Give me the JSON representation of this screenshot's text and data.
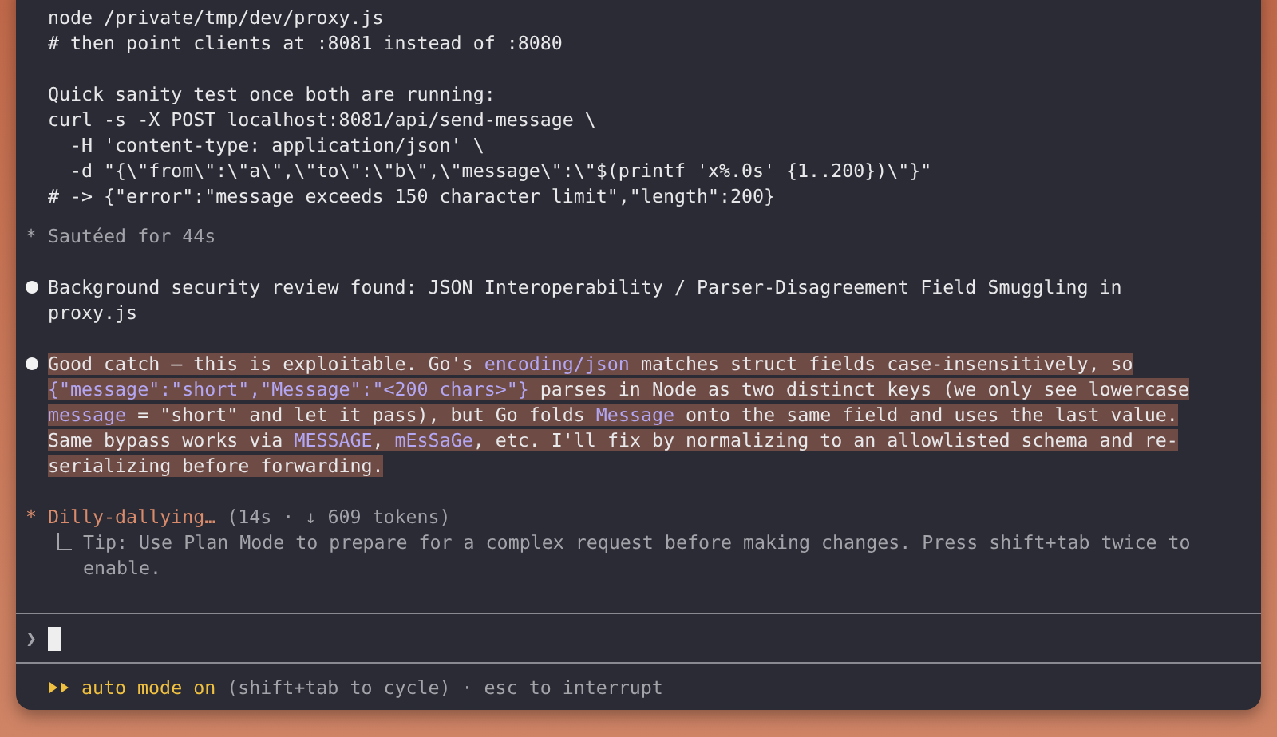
{
  "transcript": {
    "code_blocks": [
      [
        "node /private/tmp/dev/proxy.js",
        "# then point clients at :8081 instead of :8080"
      ],
      [
        "Quick sanity test once both are running:",
        "curl -s -X POST localhost:8081/api/send-message \\",
        "  -H 'content-type: application/json' \\",
        "  -d \"{\\\"from\\\":\\\"a\\\",\\\"to\\\":\\\"b\\\",\\\"message\\\":\\\"$(printf 'x%.0s' {1..200})\\\"}\"",
        "# -> {\"error\":\"message exceeds 150 character limit\",\"length\":200}"
      ]
    ],
    "status": {
      "symbol": "*",
      "text": "Sautéed for 44s"
    },
    "messages": [
      {
        "highlighted": false,
        "segments": [
          {
            "kind": "plain",
            "text": "Background security review found: JSON Interoperability / Parser-Disagreement Field Smuggling in proxy.js"
          }
        ]
      },
      {
        "highlighted": true,
        "segments": [
          {
            "kind": "plain",
            "text": "Good catch — this is exploitable. Go's "
          },
          {
            "kind": "code",
            "text": "encoding/json"
          },
          {
            "kind": "plain",
            "text": " matches struct fields case-insensitively, so "
          },
          {
            "kind": "code",
            "text": "{\"message\":\"short\",\"Message\":\"<200 chars>\"}"
          },
          {
            "kind": "plain",
            "text": " parses in Node as two distinct keys (we only see lowercase "
          },
          {
            "kind": "code",
            "text": "message"
          },
          {
            "kind": "plain",
            "text": " = \"short\" and let it pass), but Go folds "
          },
          {
            "kind": "code",
            "text": "Message"
          },
          {
            "kind": "plain",
            "text": " onto the same field and uses the last value. Same bypass works via "
          },
          {
            "kind": "code",
            "text": "MESSAGE"
          },
          {
            "kind": "plain",
            "text": ", "
          },
          {
            "kind": "code",
            "text": "mEsSaGe"
          },
          {
            "kind": "plain",
            "text": ", etc. I'll fix by normalizing to an allowlisted schema and re-serializing before forwarding."
          }
        ]
      }
    ],
    "activity": {
      "symbol": "*",
      "label": "Dilly-dallying…",
      "detail": "(14s · ↓ 609 tokens)",
      "tip": "Tip: Use Plan Mode to prepare for a complex request before making changes. Press shift+tab twice to enable."
    }
  },
  "prompt": {
    "symbol": "❯"
  },
  "footer": {
    "mode": "auto mode on",
    "hint": "(shift+tab to cycle) · esc to interrupt"
  }
}
